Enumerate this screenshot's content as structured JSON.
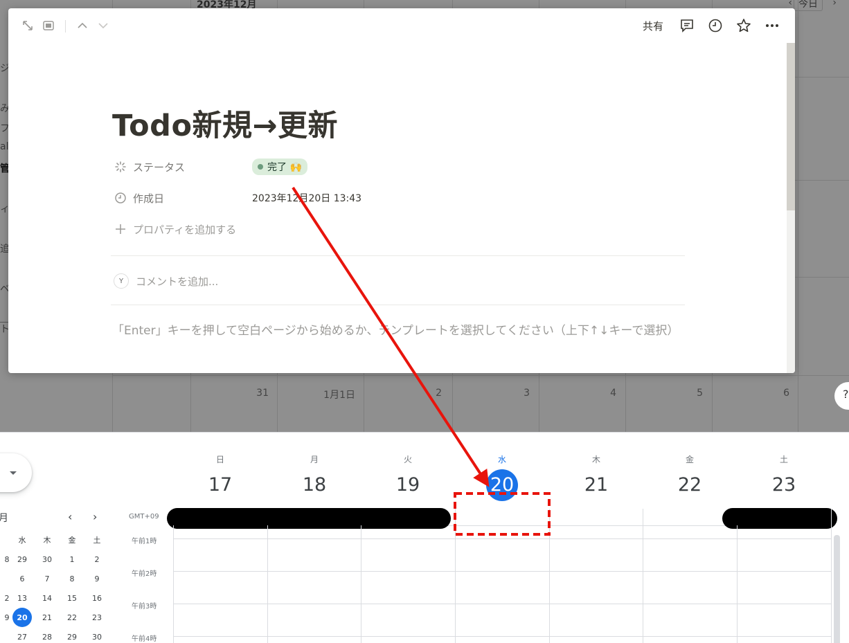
{
  "background_calendar": {
    "month_label": "2023年12月",
    "today_label": "今日",
    "prev": "‹",
    "next": "›",
    "side_chars": [
      "ジ",
      "",
      "み",
      "フ",
      "al",
      "管",
      "",
      "ィ",
      "",
      "追",
      "",
      "ベ",
      "",
      "ト"
    ],
    "day_numbers": [
      "31",
      "1月1日",
      "2",
      "3",
      "4",
      "5",
      "6"
    ],
    "help_label": "?"
  },
  "modal": {
    "share_label": "共有",
    "title": "Todo新規→更新",
    "properties": [
      {
        "name": "ステータス",
        "value": "完了 🙌",
        "icon": "status-spinner-icon"
      },
      {
        "name": "作成日",
        "value": "2023年12月20日 13:43",
        "icon": "clock-icon"
      }
    ],
    "add_property_label": "プロパティを追加する",
    "comment_avatar": "Y",
    "comment_placeholder": "コメントを追加...",
    "hint_text": "「Enter」キーを押して空白ページから始めるか、テンプレートを選択してください（上下↑↓キーで選択）",
    "status_color": "#dbeddb"
  },
  "gcal": {
    "mini": {
      "month_label": "月",
      "prev": "‹",
      "next": "›",
      "headers": [
        "",
        "水",
        "木",
        "金",
        "土"
      ],
      "rows": [
        [
          "8",
          "29",
          "30",
          "1",
          "2"
        ],
        [
          "",
          "6",
          "7",
          "8",
          "9"
        ],
        [
          "2",
          "13",
          "14",
          "15",
          "16"
        ],
        [
          "9",
          "20",
          "21",
          "22",
          "23"
        ],
        [
          "",
          "27",
          "28",
          "29",
          "30"
        ]
      ],
      "today": "20"
    },
    "days": [
      {
        "dow": "日",
        "num": "17"
      },
      {
        "dow": "月",
        "num": "18"
      },
      {
        "dow": "火",
        "num": "19"
      },
      {
        "dow": "水",
        "num": "20",
        "today": true
      },
      {
        "dow": "木",
        "num": "21"
      },
      {
        "dow": "金",
        "num": "22"
      },
      {
        "dow": "土",
        "num": "23"
      }
    ],
    "timezone": "GMT+09",
    "time_labels": [
      "午前1時",
      "午前2時",
      "午前3時",
      "午前4時"
    ],
    "accent_color": "#1a73e8"
  },
  "annotation": {
    "arrow_color": "#e8140c",
    "box_color": "#e8140c"
  }
}
